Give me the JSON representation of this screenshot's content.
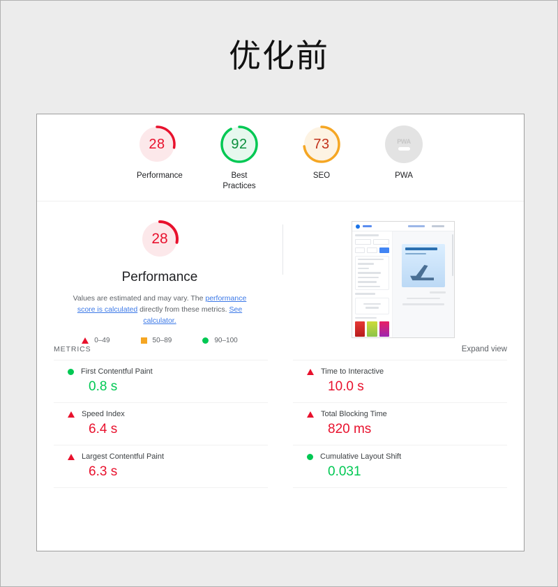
{
  "page": {
    "title": "优化前",
    "background_color": "#ececec"
  },
  "colors": {
    "fail": "#e8112d",
    "average": "#f5a623",
    "pass": "#00c853",
    "null_gray": "#d9d9d9",
    "link": "#3b78e7"
  },
  "category_scores": [
    {
      "name": "Performance",
      "score": "28",
      "status": "fail",
      "color": "#e8112d",
      "track": "#fce8ea",
      "percent": 28
    },
    {
      "name": "Best Practices",
      "score": "92",
      "status": "pass",
      "color": "#00c853",
      "track": "#e6f8ee",
      "percent": 92
    },
    {
      "name": "SEO",
      "score": "73",
      "status": "average",
      "color": "#f5a623",
      "track": "#fdf3e3",
      "percent": 73
    },
    {
      "name": "PWA",
      "score": "PWA",
      "status": "null",
      "color": "#d9d9d9",
      "track": "#e3e3e3",
      "percent": 0
    }
  ],
  "performance": {
    "score": "28",
    "title": "Performance",
    "percent": 28,
    "color": "#e8112d",
    "track": "#fce8ea",
    "description": {
      "lead": "Values are estimated and may vary. The ",
      "link1": "performance score is calculated",
      "middle": " directly from these metrics. ",
      "link2": "See calculator."
    },
    "legend": [
      {
        "shape": "triangle",
        "label": "0–49",
        "color": "#e8112d"
      },
      {
        "shape": "square",
        "label": "50–89",
        "color": "#f5a623"
      },
      {
        "shape": "circle",
        "label": "90–100",
        "color": "#00c853"
      }
    ]
  },
  "metrics_section": {
    "heading": "METRICS",
    "expand_view": "Expand view",
    "left_column": [
      {
        "name": "First Contentful Paint",
        "value": "0.8 s",
        "status": "pass",
        "color": "#00c853"
      },
      {
        "name": "Speed Index",
        "value": "6.4 s",
        "status": "fail",
        "color": "#e8112d"
      },
      {
        "name": "Largest Contentful Paint",
        "value": "6.3 s",
        "status": "fail",
        "color": "#e8112d"
      }
    ],
    "right_column": [
      {
        "name": "Time to Interactive",
        "value": "10.0 s",
        "status": "fail",
        "color": "#e8112d"
      },
      {
        "name": "Total Blocking Time",
        "value": "820 ms",
        "status": "fail",
        "color": "#e8112d"
      },
      {
        "name": "Cumulative Layout Shift",
        "value": "0.031",
        "status": "pass",
        "color": "#00c853"
      }
    ]
  },
  "screenshot_thumbnail": {
    "alt": "page-screenshot-thumbnail"
  }
}
